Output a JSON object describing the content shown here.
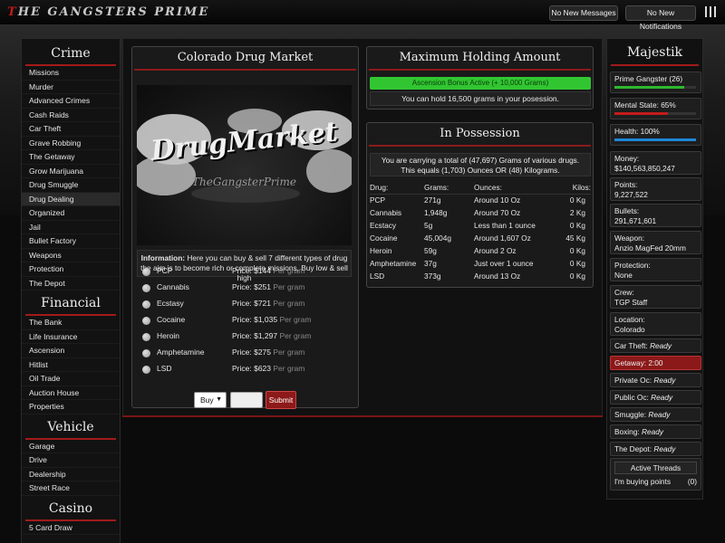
{
  "header": {
    "logo_first": "T",
    "logo_rest": "he Gangsters Prime",
    "messages": "No New Messages",
    "notifications": "No New Notifications"
  },
  "left": {
    "crime_title": "Crime",
    "crime": [
      "Missions",
      "Murder",
      "Advanced Crimes",
      "Cash Raids",
      "Car Theft",
      "Grave Robbing",
      "The Getaway",
      "Grow Marijuana",
      "Drug Smuggle",
      "Drug Dealing",
      "Organized",
      "Jail",
      "Bullet Factory",
      "Weapons",
      "Protection",
      "The Depot"
    ],
    "financial_title": "Financial",
    "financial": [
      "The Bank",
      "Life Insurance",
      "Ascension",
      "Hitlist",
      "Oil Trade",
      "Auction House",
      "Properties"
    ],
    "vehicle_title": "Vehicle",
    "vehicle": [
      "Garage",
      "Drive",
      "Dealership",
      "Street Race"
    ],
    "casino_title": "Casino",
    "casino": [
      "5 Card Draw"
    ]
  },
  "market": {
    "title": "Colorado Drug Market",
    "image_text": "DrugMarket",
    "image_sub": "TheGangsterPrime",
    "info_bold": "Information:",
    "info_line1": " Here you can buy & sell 7 different types of drug",
    "info_line2": "the aim is to become rich or complete missions, Buy low & sell high",
    "per_gram": "Per gram",
    "drugs": [
      {
        "name": "PCP",
        "price": "Price: $144"
      },
      {
        "name": "Cannabis",
        "price": "Price: $251"
      },
      {
        "name": "Ecstasy",
        "price": "Price: $721"
      },
      {
        "name": "Cocaine",
        "price": "Price: $1,035"
      },
      {
        "name": "Heroin",
        "price": "Price: $1,297"
      },
      {
        "name": "Amphetamine",
        "price": "Price: $275"
      },
      {
        "name": "LSD",
        "price": "Price: $623"
      }
    ],
    "action": "Buy",
    "submit": "Submit"
  },
  "holding": {
    "title": "Maximum Holding Amount",
    "bonus": "Ascension Bonus Active (+ 10,000 Grams)",
    "capacity": "You can hold 16,500 grams in your posession."
  },
  "possession": {
    "title": "In Possession",
    "line1": "You are carrying a total of (47,697) Grams of various drugs.",
    "line2": "This equals (1,703) Ounces OR (48) Kilograms.",
    "headers": [
      "Drug:",
      "Grams:",
      "Ounces:",
      "Kilos:"
    ],
    "rows": [
      [
        "PCP",
        "271g",
        "Around 10 Oz",
        "0 Kg"
      ],
      [
        "Cannabis",
        "1,948g",
        "Around 70 Oz",
        "2 Kg"
      ],
      [
        "Ecstacy",
        "5g",
        "Less than 1 ounce",
        "0 Kg"
      ],
      [
        "Cocaine",
        "45,004g",
        "Around 1,607 Oz",
        "45 Kg"
      ],
      [
        "Heroin",
        "59g",
        "Around 2 Oz",
        "0 Kg"
      ],
      [
        "Amphetamine",
        "37g",
        "Just over 1 ounce",
        "0 Kg"
      ],
      [
        "LSD",
        "373g",
        "Around 13 Oz",
        "0 Kg"
      ]
    ]
  },
  "right": {
    "name": "Majestik",
    "rank": "Prime Gangster (26)",
    "rank_pct": 0.85,
    "mental": "Mental State: 65%",
    "mental_pct": 0.65,
    "health": "Health: 100%",
    "health_pct": 1.0,
    "money_label": "Money:",
    "money": "$140,563,850,247",
    "points_label": "Points:",
    "points": "9,227,522",
    "bullets_label": "Bullets:",
    "bullets": "291,671,601",
    "weapon_label": "Weapon:",
    "weapon": "Anzio MagFed 20mm",
    "protection_label": "Protection:",
    "protection": "None",
    "crew_label": "Crew:",
    "crew": "TGP Staff",
    "location_label": "Location:",
    "location": "Colorado",
    "timers": [
      {
        "label": "Car Theft:",
        "value": "Ready"
      },
      {
        "label": "Getaway:",
        "value": "2:00"
      },
      {
        "label": "Private Oc:",
        "value": "Ready"
      },
      {
        "label": "Public Oc:",
        "value": "Ready"
      },
      {
        "label": "Smuggle:",
        "value": "Ready"
      },
      {
        "label": "Boxing:",
        "value": "Ready"
      },
      {
        "label": "The Depot:",
        "value": "Ready"
      }
    ],
    "threads_title": "Active Threads",
    "thread": "I'm buying points",
    "thread_count": "(0)",
    "colors": {
      "rank": "#2eb82e",
      "mental": "#c21b1b",
      "health": "#1e88d8"
    }
  }
}
